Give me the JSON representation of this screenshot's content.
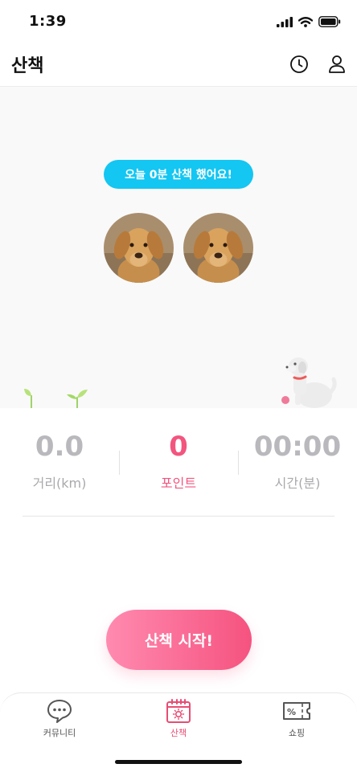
{
  "status_bar": {
    "time": "1:39",
    "icons": [
      "cellular-signal-icon",
      "wifi-icon",
      "battery-icon"
    ]
  },
  "header": {
    "title": "산책",
    "icons": [
      "clock-icon",
      "user-icon"
    ]
  },
  "hero": {
    "today_message": "오늘 0분 산책 했어요!",
    "pill_color": "#14c6f2",
    "dog_avatars": [
      "dog-photo-1",
      "dog-photo-2"
    ]
  },
  "stats": {
    "distance": {
      "value": "0.0",
      "label": "거리(km)"
    },
    "points": {
      "value": "0",
      "label": "포인트",
      "color": "#f2557e"
    },
    "time": {
      "value": "00:00",
      "label": "시간(분)"
    }
  },
  "start_button": {
    "label": "산책 시작!",
    "gradient": [
      "#ff8ab0",
      "#f5537f"
    ]
  },
  "tab_bar": {
    "active": "walk",
    "tabs": [
      {
        "id": "community",
        "label": "커뮤니티",
        "icon": "chat-bubble-icon"
      },
      {
        "id": "walk",
        "label": "산책",
        "icon": "calendar-sun-icon"
      },
      {
        "id": "shopping",
        "label": "쇼핑",
        "icon": "coupon-icon"
      }
    ]
  }
}
